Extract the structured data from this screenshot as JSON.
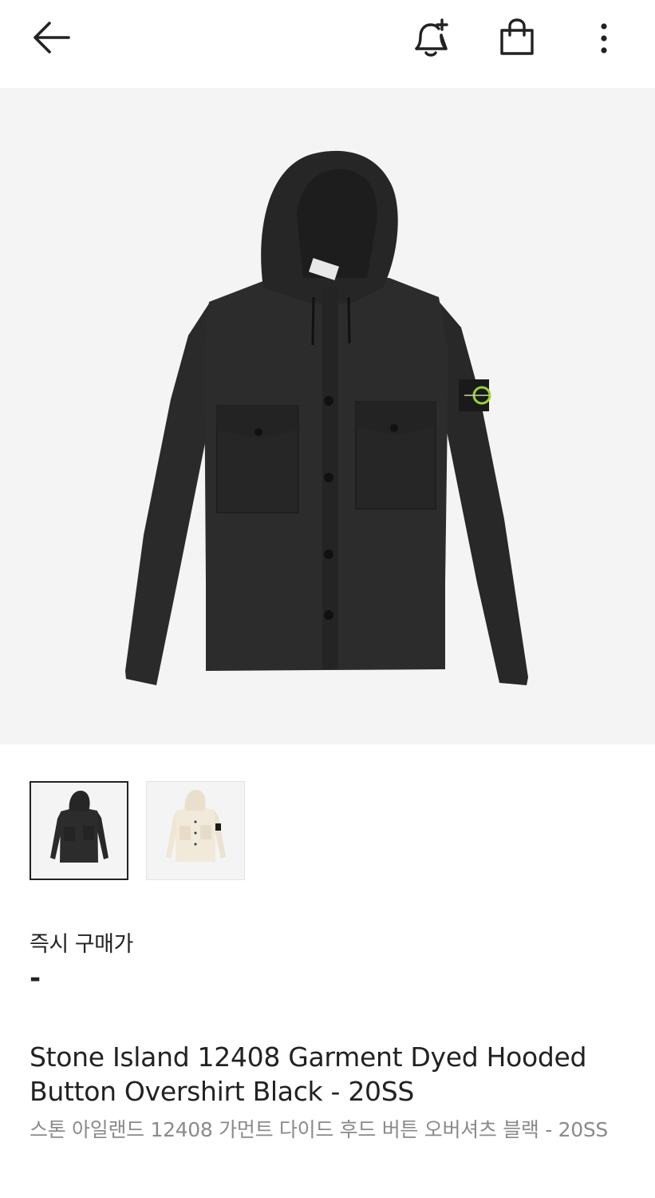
{
  "header": {
    "back_icon": "arrow-left-icon",
    "alert_icon": "bell-plus-icon",
    "cart_icon": "shopping-bag-icon",
    "menu_icon": "more-vertical-icon"
  },
  "gallery": {
    "background": "#f4f4f4",
    "thumbnails": [
      {
        "color": "black",
        "selected": true
      },
      {
        "color": "cream",
        "selected": false
      }
    ]
  },
  "price": {
    "label": "즉시 구매가",
    "value": "-"
  },
  "product": {
    "name_en": "Stone Island 12408 Garment Dyed Hooded Button Overshirt Black - 20SS",
    "name_ko": "스톤 아일랜드 12408 가먼트 다이드 후드 버튼 오버셔츠 블랙 - 20SS"
  },
  "colors": {
    "text_primary": "#222222",
    "text_secondary": "#8a8a8a",
    "jacket_black": "#2a2a2a",
    "jacket_cream": "#efe6d6",
    "badge_green": "#9bd23a"
  }
}
